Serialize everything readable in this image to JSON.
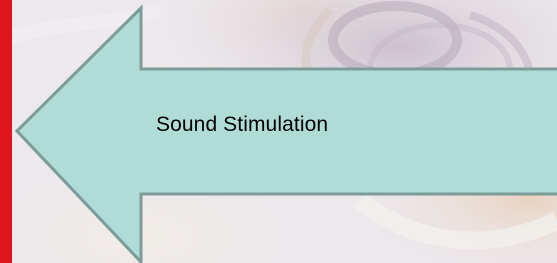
{
  "arrow": {
    "label": "Sound Stimulation",
    "direction": "left",
    "fill_color": "#b0dcd8",
    "stroke_color": "#7b9c98"
  },
  "colors": {
    "side_bar": "#e0141c",
    "background": "#ece8ec"
  }
}
